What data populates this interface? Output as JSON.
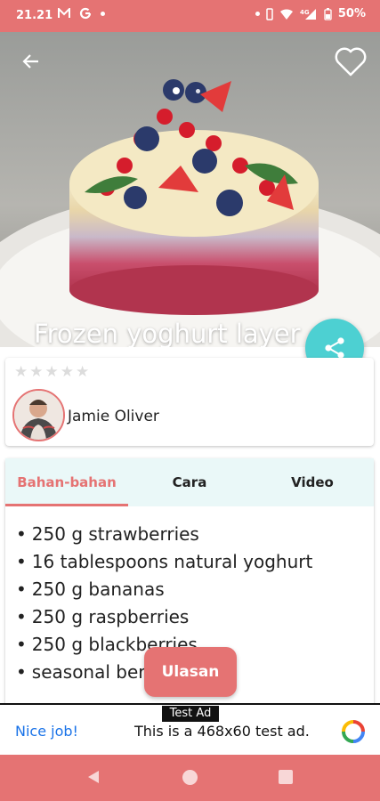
{
  "status_bar": {
    "time": "21.21",
    "left_icons": [
      "m-icon",
      "google-icon",
      "dot"
    ],
    "battery": "50%",
    "network": "4G"
  },
  "hero": {
    "title": "Frozen yoghurt layer c...",
    "carousel_total": 2,
    "carousel_active": 1,
    "back_icon": "arrow-left-icon",
    "favorite_icon": "heart-outline-icon"
  },
  "share": {
    "icon": "share-icon"
  },
  "author": {
    "rating": 0,
    "max_rating": 5,
    "name": "Jamie Oliver"
  },
  "tabs": [
    {
      "label": "Bahan-bahan",
      "active": true
    },
    {
      "label": "Cara",
      "active": false
    },
    {
      "label": "Video",
      "active": false
    }
  ],
  "ingredients": [
    "250 g strawberries",
    "16 tablespoons natural yoghurt",
    "250 g bananas",
    "250 g raspberries",
    "250 g blackberries",
    "seasonal berries"
  ],
  "review_button": {
    "label": "Ulasan"
  },
  "ad": {
    "tag": "Test Ad",
    "left_text": "Nice job!",
    "main_text": "This is a 468x60 test ad."
  },
  "colors": {
    "primary": "#e57373",
    "accent": "#4dd0d2",
    "tab_bg": "#eaf8f8"
  }
}
